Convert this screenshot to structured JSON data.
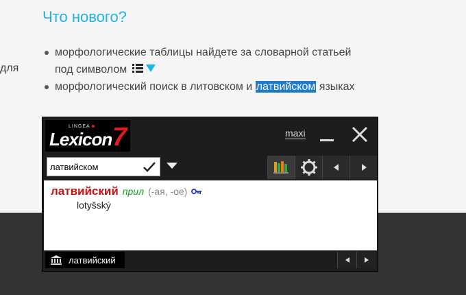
{
  "page": {
    "heading": "Что нового?",
    "cut_text": "для",
    "bullets": {
      "item1_text": "морфологические таблицы найдете за словарной статьей под символом",
      "item1_symbol_icon": "list-arrow-icon",
      "item2_before": "морфологический поиск в литовском и ",
      "item2_highlight": "латвийском",
      "item2_after": " языках"
    }
  },
  "lexicon": {
    "logo_small": "LINGEA",
    "logo_brand": "Lexicon",
    "logo_version": "7",
    "maxi_label": "maxi",
    "search": {
      "value": "латвийском"
    },
    "entry": {
      "headword": "латвийский",
      "pos": "прил",
      "forms": "(-ая, -ое)",
      "translation": "lotyšský"
    },
    "history": {
      "word": "латвийский"
    },
    "colors": {
      "accent_red": "#e21b1b",
      "headword": "#cc1111",
      "pos": "#1a9c1a",
      "highlight": "#1f7bc8",
      "heading": "#1fb3e8"
    }
  }
}
